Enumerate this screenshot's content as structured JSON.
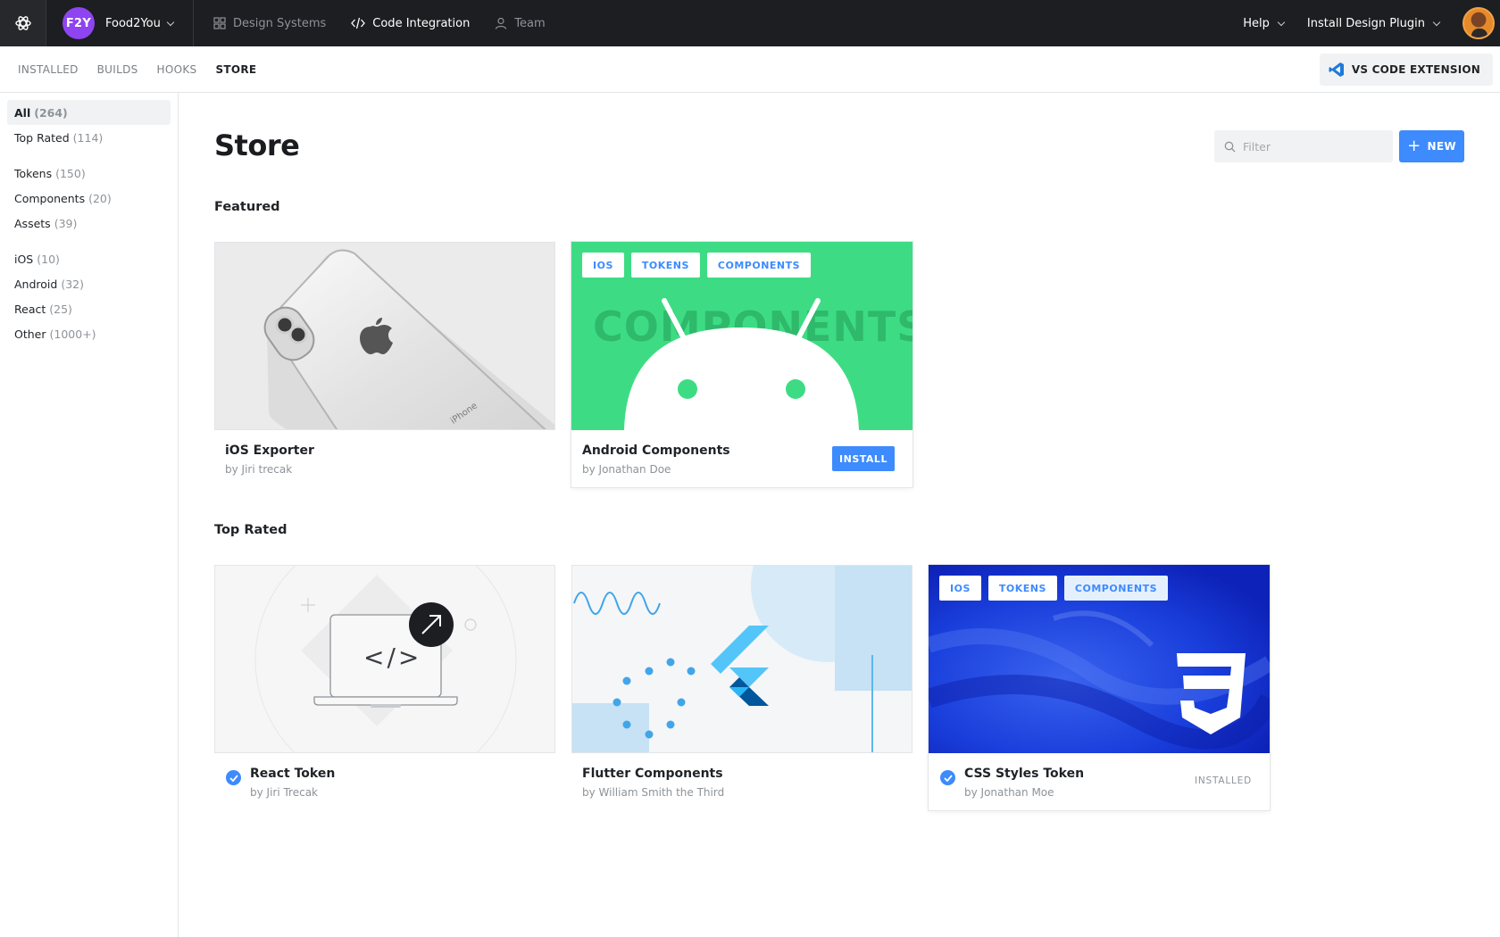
{
  "topbar": {
    "workspace": {
      "initials": "F2Y",
      "name": "Food2You",
      "color": "#8e44f0"
    },
    "nav": [
      {
        "label": "Design Systems",
        "icon": "grid-icon",
        "active": false
      },
      {
        "label": "Code Integration",
        "icon": "code-icon",
        "active": true
      },
      {
        "label": "Team",
        "icon": "user-icon",
        "active": false
      }
    ],
    "help_label": "Help",
    "plugin_label": "Install Design Plugin"
  },
  "subnav": {
    "items": [
      "INSTALLED",
      "BUILDS",
      "HOOKS",
      "STORE"
    ],
    "active": "STORE",
    "vscode_label": "VS CODE EXTENSION"
  },
  "sidebar": {
    "groups": [
      [
        {
          "label": "All",
          "count": "(264)",
          "active": true
        },
        {
          "label": "Top Rated",
          "count": "(114)"
        }
      ],
      [
        {
          "label": "Tokens",
          "count": "(150)"
        },
        {
          "label": "Components",
          "count": "(20)"
        },
        {
          "label": "Assets",
          "count": "(39)"
        }
      ],
      [
        {
          "label": "iOS",
          "count": "(10)"
        },
        {
          "label": "Android",
          "count": "(32)"
        },
        {
          "label": "React",
          "count": "(25)"
        },
        {
          "label": "Other",
          "count": "(1000+)"
        }
      ]
    ]
  },
  "main": {
    "title": "Store",
    "filter_placeholder": "Filter",
    "new_label": "NEW",
    "featured_title": "Featured",
    "top_rated_title": "Top Rated",
    "featured": [
      {
        "title": "iOS Exporter",
        "author": "by Jiri trecak",
        "thumb_text": "iPhone"
      },
      {
        "title": "Android Components",
        "author": "by Jonathan Doe",
        "tags": [
          "IOS",
          "TOKENS",
          "COMPONENTS"
        ],
        "watermark": "COMPONENTS",
        "action": "INSTALL"
      }
    ],
    "top_rated": [
      {
        "title": "React Token",
        "author": "by Jiri Trecak",
        "code_glyph": "</>"
      },
      {
        "title": "Flutter Components",
        "author": "by William Smith the Third"
      },
      {
        "title": "CSS Styles Token",
        "author": "by Jonathan Moe",
        "tags": [
          "IOS",
          "TOKENS",
          "COMPONENTS"
        ],
        "status": "INSTALLED"
      }
    ]
  },
  "colors": {
    "accent": "#3d8bfd",
    "topbar": "#1c1e21",
    "android_green": "#3ddc84",
    "css_blue": "#1538d8"
  }
}
